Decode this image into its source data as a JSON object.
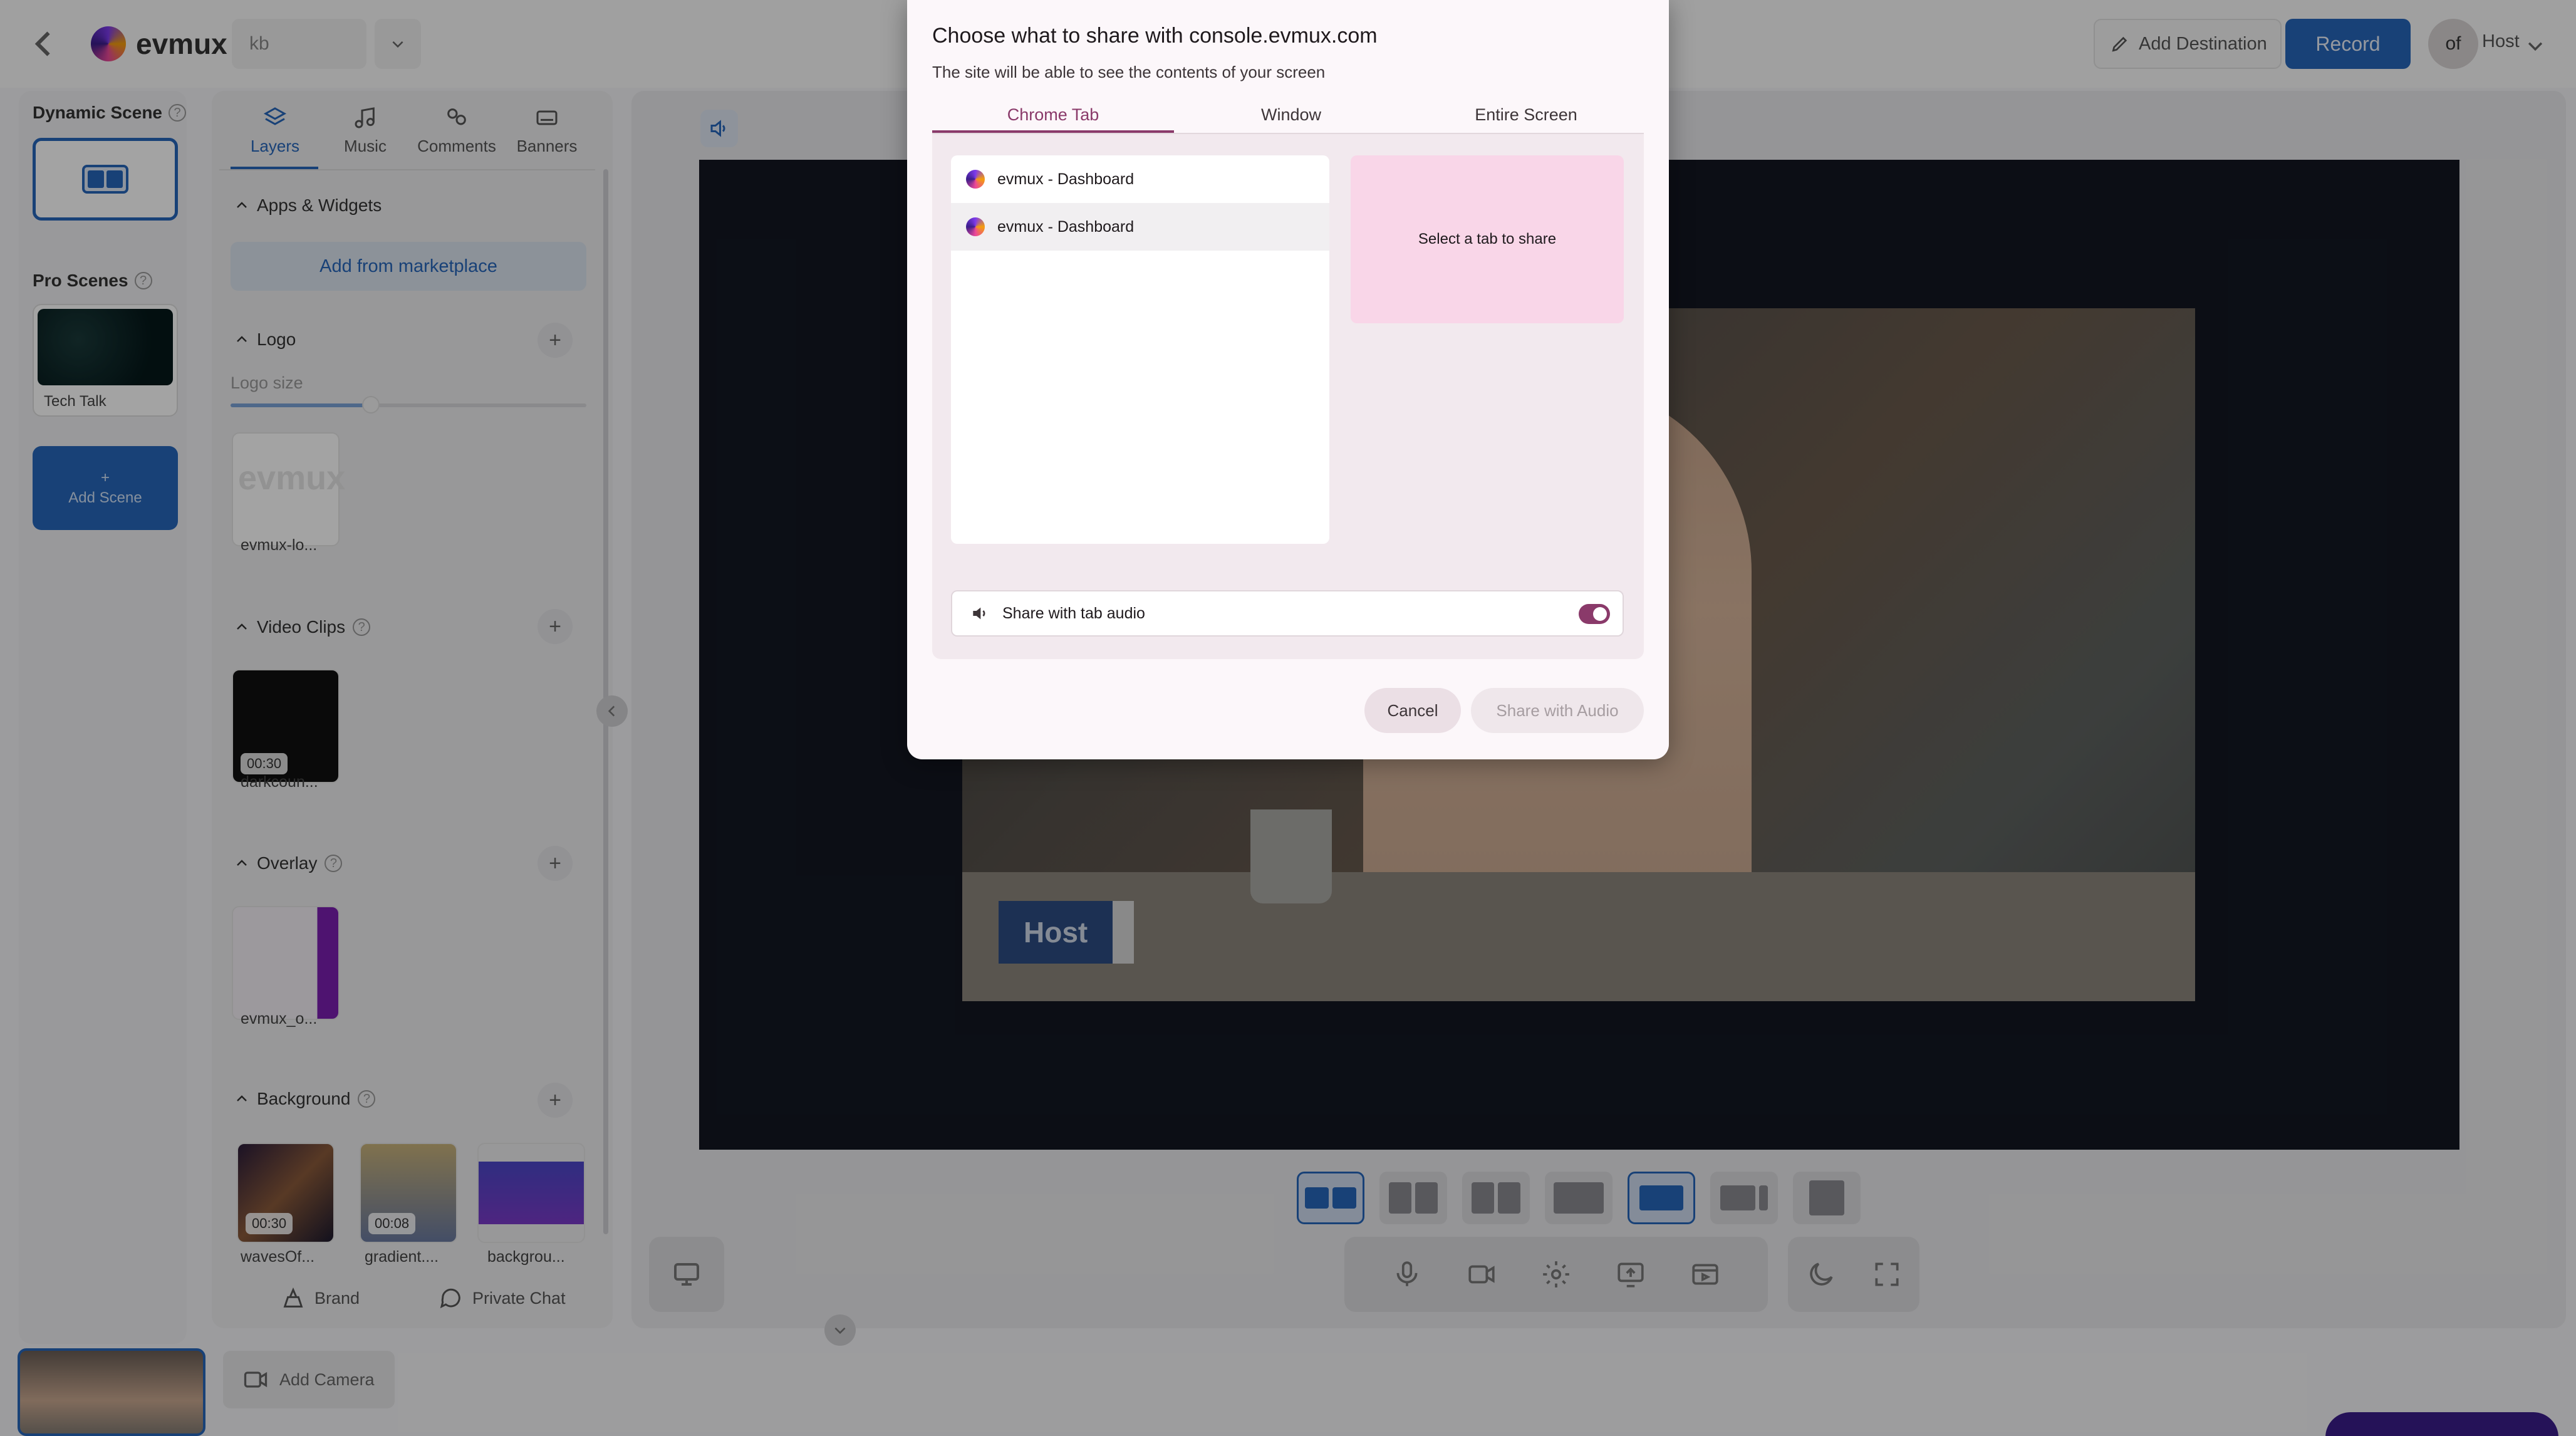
{
  "topbar": {
    "app_name": "evmux",
    "studio_name": "kb",
    "add_destination": "Add Destination",
    "record": "Record",
    "avatar_initials": "of",
    "user_name": "Host"
  },
  "scenes": {
    "dynamic_title": "Dynamic Scene",
    "pro_title": "Pro Scenes",
    "pro_scene_name": "Tech Talk",
    "add_scene_plus": "+",
    "add_scene": "Add Scene"
  },
  "panel": {
    "tabs": [
      {
        "label": "Layers",
        "icon": "layers-icon"
      },
      {
        "label": "Music",
        "icon": "music-icon"
      },
      {
        "label": "Comments",
        "icon": "comments-icon"
      },
      {
        "label": "Banners",
        "icon": "banners-icon"
      }
    ],
    "apps_title": "Apps & Widgets",
    "add_marketplace": "Add from marketplace",
    "logo_title": "Logo",
    "logo_size_label": "Logo size",
    "logo_size_value": 0.4,
    "logo_asset": "evmux-lo...",
    "video_title": "Video Clips",
    "video_asset": "darkcoun...",
    "video_duration": "00:30",
    "overlay_title": "Overlay",
    "overlay_asset": "evmux_o...",
    "background_title": "Background",
    "backgrounds": [
      {
        "name": "wavesOf...",
        "duration": "00:30"
      },
      {
        "name": "gradient....",
        "duration": "00:08"
      },
      {
        "name": "backgrou...",
        "duration": ""
      }
    ],
    "brand": "Brand",
    "private_chat": "Private Chat"
  },
  "stage": {
    "host_tag": "Host"
  },
  "bottom": {
    "add_camera": "Add Camera"
  },
  "dialog": {
    "title": "Choose what to share with console.evmux.com",
    "subtitle": "The site will be able to see the contents of your screen",
    "tabs": [
      "Chrome Tab",
      "Window",
      "Entire Screen"
    ],
    "active_tab": "Chrome Tab",
    "items": [
      "evmux - Dashboard",
      "evmux - Dashboard"
    ],
    "preview_text": "Select a tab to share",
    "audio_label": "Share with tab audio",
    "audio_enabled": true,
    "cancel": "Cancel",
    "share": "Share with Audio"
  }
}
